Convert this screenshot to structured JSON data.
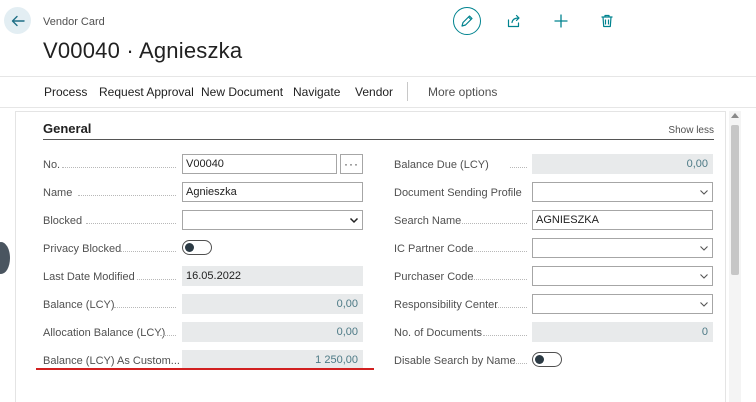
{
  "header": {
    "breadcrumb": "Vendor Card",
    "title": "V00040 · Agnieszka"
  },
  "top_actions": [
    {
      "name": "edit-icon"
    },
    {
      "name": "share-icon"
    },
    {
      "name": "new-icon"
    },
    {
      "name": "delete-icon"
    }
  ],
  "actionbar": {
    "process": "Process",
    "request_approval": "Request Approval",
    "new_document": "New Document",
    "navigate": "Navigate",
    "vendor": "Vendor",
    "more_options": "More options"
  },
  "general": {
    "title": "General",
    "show_less": "Show less",
    "left": {
      "no_label": "No.",
      "no_value": "V00040",
      "assist_label": "···",
      "name_label": "Name",
      "name_value": "Agnieszka",
      "blocked_label": "Blocked",
      "blocked_value": "",
      "privacy_blocked_label": "Privacy Blocked",
      "last_date_modified_label": "Last Date Modified",
      "last_date_modified_value": "16.05.2022",
      "balance_lcy_label": "Balance (LCY)",
      "balance_lcy_value": "0,00",
      "allocation_balance_label": "Allocation Balance (LCY)",
      "allocation_balance_value": "0,00",
      "balance_as_customer_label": "Balance (LCY) As Custom...",
      "balance_as_customer_value": "1 250,00"
    },
    "right": {
      "balance_due_label": "Balance Due (LCY)",
      "balance_due_value": "0,00",
      "doc_sending_profile_label": "Document Sending Profile",
      "doc_sending_profile_value": "",
      "search_name_label": "Search Name",
      "search_name_value": "AGNIESZKA",
      "ic_partner_code_label": "IC Partner Code",
      "ic_partner_code_value": "",
      "purchaser_code_label": "Purchaser Code",
      "purchaser_code_value": "",
      "responsibility_center_label": "Responsibility Center",
      "responsibility_center_value": "",
      "no_of_documents_label": "No. of Documents",
      "no_of_documents_value": "0",
      "disable_search_label": "Disable Search by Name"
    }
  },
  "colors": {
    "accent": "#00838f",
    "highlight_underline": "#d12020",
    "readonly_bg": "#e8eaeb"
  }
}
